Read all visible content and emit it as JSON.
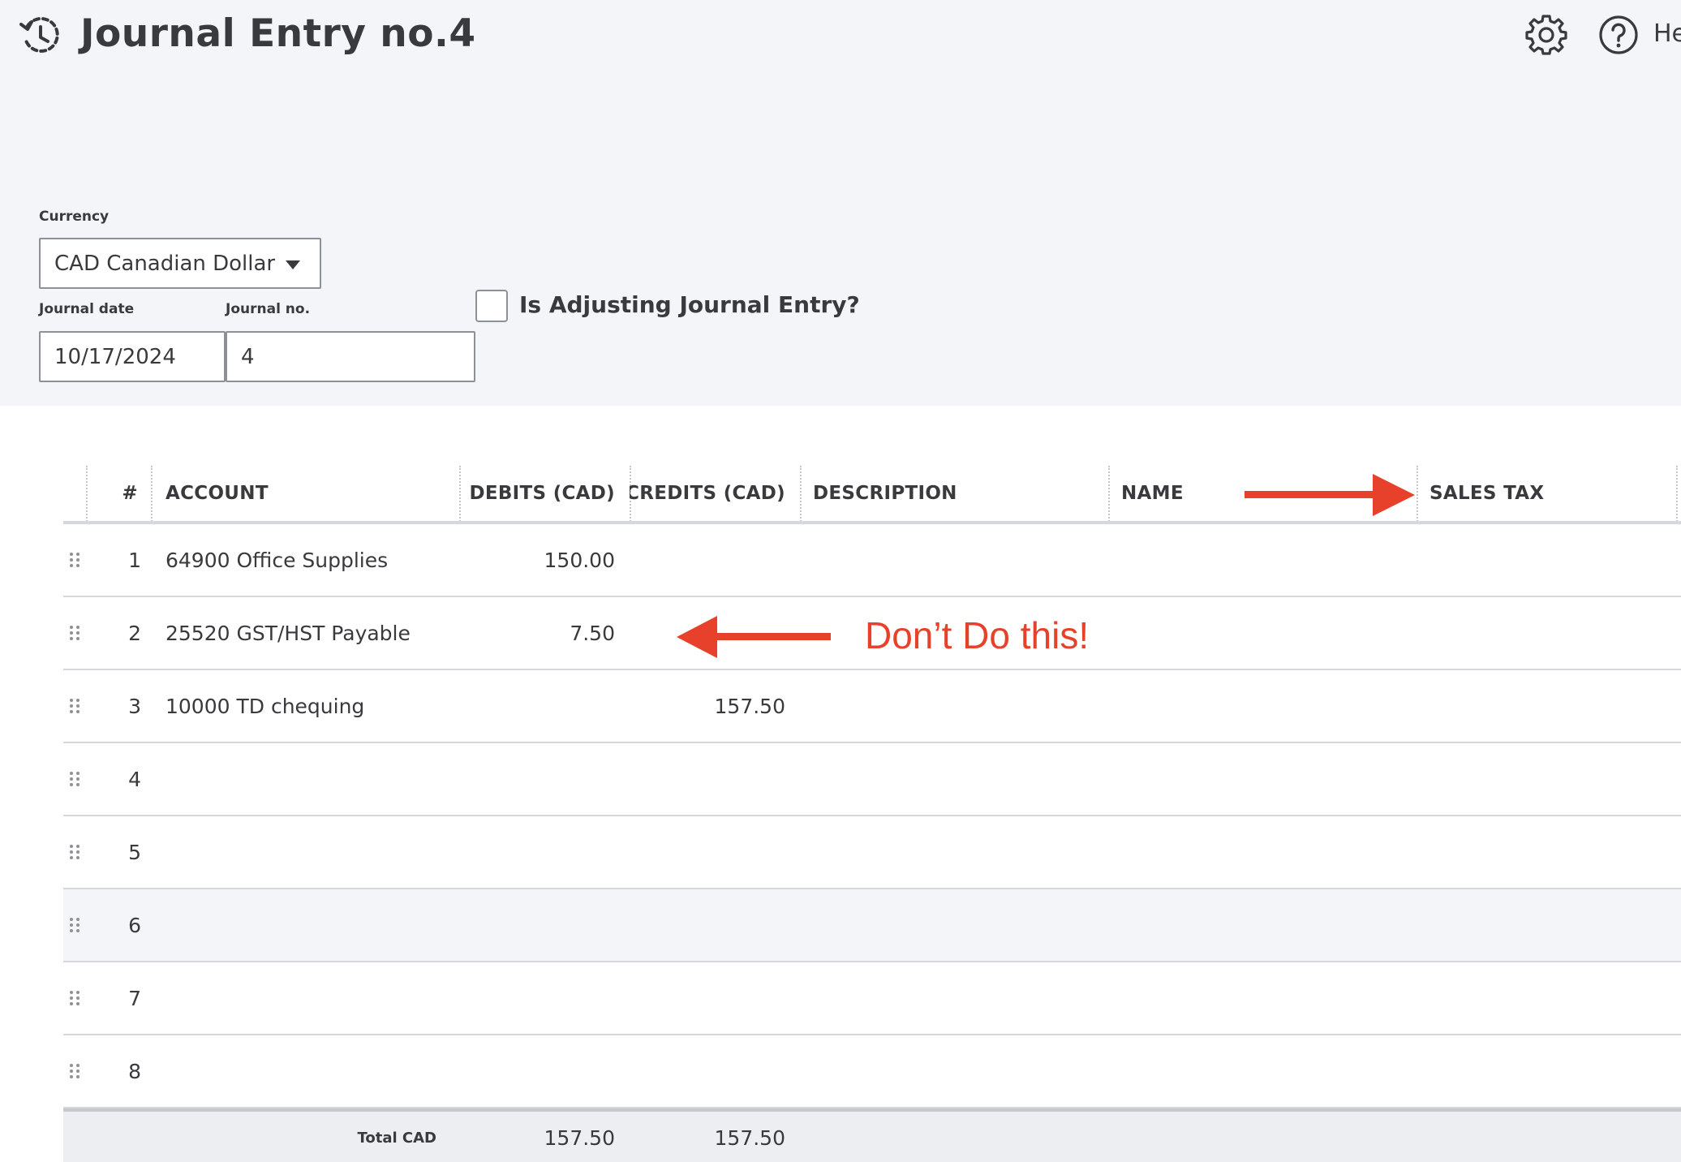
{
  "header": {
    "title": "Journal Entry no.4",
    "help_label": "He"
  },
  "form": {
    "currency_label": "Currency",
    "currency_value": "CAD Canadian Dollar",
    "journal_date_label": "Journal date",
    "journal_date_value": "10/17/2024",
    "journal_no_label": "Journal no.",
    "journal_no_value": "4",
    "adjusting_label": "Is Adjusting Journal Entry?"
  },
  "table": {
    "headers": {
      "num": "#",
      "account": "ACCOUNT",
      "debits": "DEBITS (CAD)",
      "credits": "CREDITS (CAD)",
      "description": "DESCRIPTION",
      "name": "NAME",
      "sales_tax": "SALES TAX"
    },
    "rows": [
      {
        "num": "1",
        "account": "64900 Office Supplies",
        "debit": "150.00",
        "credit": "",
        "description": "",
        "name": "",
        "sales_tax": ""
      },
      {
        "num": "2",
        "account": "25520 GST/HST Payable",
        "debit": "7.50",
        "credit": "",
        "description": "",
        "name": "",
        "sales_tax": ""
      },
      {
        "num": "3",
        "account": "10000 TD chequing",
        "debit": "",
        "credit": "157.50",
        "description": "",
        "name": "",
        "sales_tax": ""
      },
      {
        "num": "4",
        "account": "",
        "debit": "",
        "credit": "",
        "description": "",
        "name": "",
        "sales_tax": ""
      },
      {
        "num": "5",
        "account": "",
        "debit": "",
        "credit": "",
        "description": "",
        "name": "",
        "sales_tax": ""
      },
      {
        "num": "6",
        "account": "",
        "debit": "",
        "credit": "",
        "description": "",
        "name": "",
        "sales_tax": ""
      },
      {
        "num": "7",
        "account": "",
        "debit": "",
        "credit": "",
        "description": "",
        "name": "",
        "sales_tax": ""
      },
      {
        "num": "8",
        "account": "",
        "debit": "",
        "credit": "",
        "description": "",
        "name": "",
        "sales_tax": ""
      }
    ],
    "total_label": "Total CAD",
    "total_debits": "157.50",
    "total_credits": "157.50"
  },
  "annotation": {
    "text": "Don’t Do this!",
    "color": "#e8412b"
  },
  "icons": {
    "history": "history-icon",
    "settings": "gear-icon",
    "help": "help-icon",
    "drag": "drag-handle-icon",
    "dropdown": "chevron-down-icon"
  }
}
